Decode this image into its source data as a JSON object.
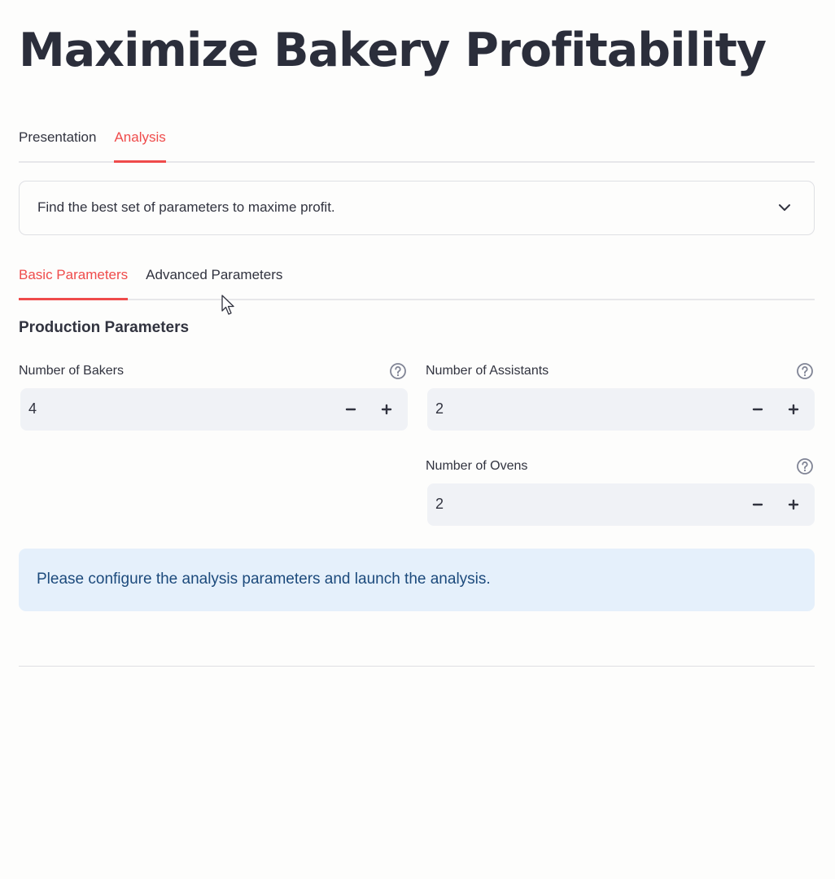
{
  "title": "Maximize Bakery Profitability",
  "main_tabs": [
    {
      "label": "Presentation",
      "active": false
    },
    {
      "label": "Analysis",
      "active": true
    }
  ],
  "expander": {
    "label": "Find the best set of parameters to maxime profit.",
    "icon": "chevron-down-icon"
  },
  "sub_tabs": [
    {
      "label": "Basic Parameters",
      "active": true
    },
    {
      "label": "Advanced Parameters",
      "active": false
    }
  ],
  "section": {
    "heading": "Production Parameters"
  },
  "fields": {
    "bakers": {
      "label": "Number of Bakers",
      "value": "4"
    },
    "assistants": {
      "label": "Number of Assistants",
      "value": "2"
    },
    "ovens": {
      "label": "Number of Ovens",
      "value": "2"
    }
  },
  "info": {
    "message": "Please configure the analysis parameters and launch the analysis."
  },
  "colors": {
    "accent": "#ef4b4b",
    "text": "#31333f",
    "input_bg": "#f0f2f6",
    "info_bg": "#e5f0fb",
    "info_text": "#1c4a7c"
  }
}
